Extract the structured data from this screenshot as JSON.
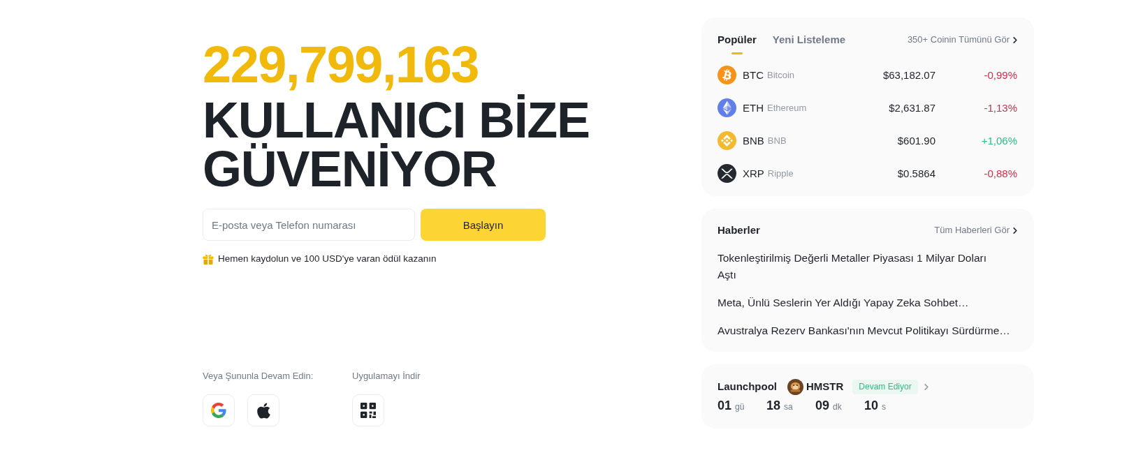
{
  "hero": {
    "user_count": "229,799,163",
    "headline": "KULLANICI BİZE GÜVENİYOR",
    "signup": {
      "placeholder": "E-posta veya Telefon numarası",
      "button": "Başlayın"
    },
    "promo": "Hemen kaydolun ve 100 USD'ye varan ödül kazanın"
  },
  "continue_with": {
    "label": "Veya Şununla Devam Edin:",
    "options": [
      {
        "kind": "google"
      },
      {
        "kind": "apple"
      }
    ]
  },
  "download_app": {
    "label": "Uygulamayı İndir",
    "options": [
      {
        "kind": "qr"
      }
    ]
  },
  "markets": {
    "tabs": [
      {
        "label": "Popüler",
        "selected": true
      },
      {
        "label": "Yeni Listeleme",
        "selected": false
      }
    ],
    "link": "350+ Coinin Tümünü Gör",
    "coins": [
      {
        "kind": "btc",
        "symbol": "BTC",
        "name": "Bitcoin",
        "price": "$63,182.07",
        "change": "-0,99%",
        "rising": false
      },
      {
        "kind": "eth",
        "symbol": "ETH",
        "name": "Ethereum",
        "price": "$2,631.87",
        "change": "-1,13%",
        "rising": false
      },
      {
        "kind": "bnb",
        "symbol": "BNB",
        "name": "BNB",
        "price": "$601.90",
        "change": "+1,06%",
        "rising": true
      },
      {
        "kind": "xrp",
        "symbol": "XRP",
        "name": "Ripple",
        "price": "$0.5864",
        "change": "-0,88%",
        "rising": false
      }
    ]
  },
  "news": {
    "title": "Haberler",
    "link": "Tüm Haberleri Gör",
    "items": [
      "Tokenleştirilmiş Değerli Metaller Piyasası 1 Milyar Doları\nAştı",
      "Meta, Ünlü Seslerin Yer Aldığı Yapay Zeka Sohbet…",
      "Avustralya Rezerv Bankası'nın Mevcut Politikayı Sürdürme…"
    ]
  },
  "launchpool": {
    "title": "Launchpool",
    "token": "HMSTR",
    "status": "Devam Ediyor",
    "countdown": [
      {
        "value": "01",
        "unit": "gü"
      },
      {
        "value": "18",
        "unit": "sa"
      },
      {
        "value": "09",
        "unit": "dk"
      },
      {
        "value": "10",
        "unit": "s"
      }
    ]
  }
}
